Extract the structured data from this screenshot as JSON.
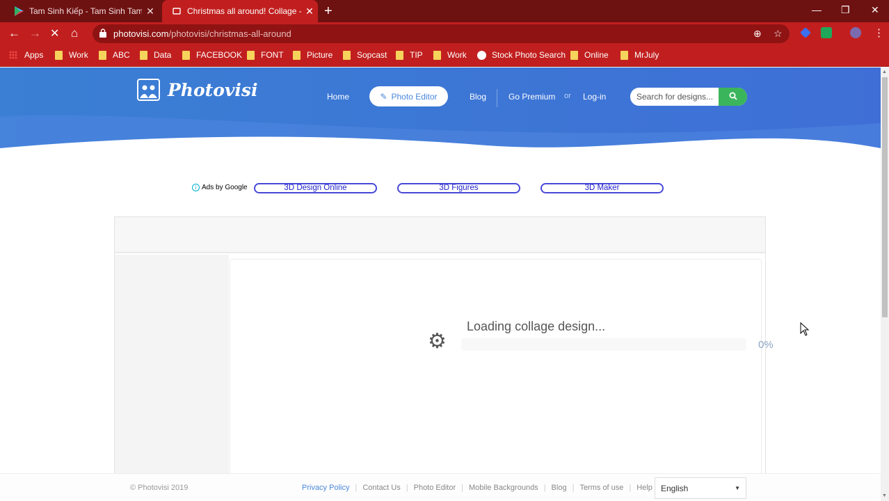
{
  "browser": {
    "tabs": [
      {
        "title": "Tam Sinh Kiếp - Tam Sinh Tam Th",
        "active": false,
        "favicon": "play-store-icon"
      },
      {
        "title": "Christmas all around! Collage - I",
        "active": true,
        "favicon": "photovisi-icon"
      }
    ],
    "url_host": "photovisi.com",
    "url_path": "/photovisi/christmas-all-around",
    "bookmarks": [
      "Apps",
      "Work",
      "ABC",
      "Data",
      "FACEBOOK",
      "FONT",
      "Picture",
      "Sopcast",
      "TIP",
      "Work",
      "Stock Photo Search",
      "Online",
      "MrJuly"
    ],
    "colors": {
      "tabbar": "#6e1111",
      "toolbar": "#c11f1f"
    }
  },
  "site": {
    "logo": "Photovisi",
    "nav": {
      "home": "Home",
      "photo_editor": "Photo Editor",
      "blog": "Blog",
      "premium": "Go Premium",
      "or": "or",
      "login": "Log-in"
    },
    "search": {
      "placeholder": "Search for designs..."
    },
    "ads": {
      "label": "Ads by Google",
      "links": [
        "3D Design Online",
        "3D Figures",
        "3D Maker"
      ]
    },
    "loader": {
      "text": "Loading collage design...",
      "progress": 0,
      "percent": "0%"
    },
    "footer": {
      "copyright": "© Photovisi 2019",
      "links": [
        "Privacy Policy",
        "Contact Us",
        "Photo Editor",
        "Mobile Backgrounds",
        "Blog",
        "Terms of use",
        "Help"
      ],
      "language": "English"
    },
    "colors": {
      "accent": "#4a87dc",
      "search_button": "#3bb55b"
    }
  }
}
